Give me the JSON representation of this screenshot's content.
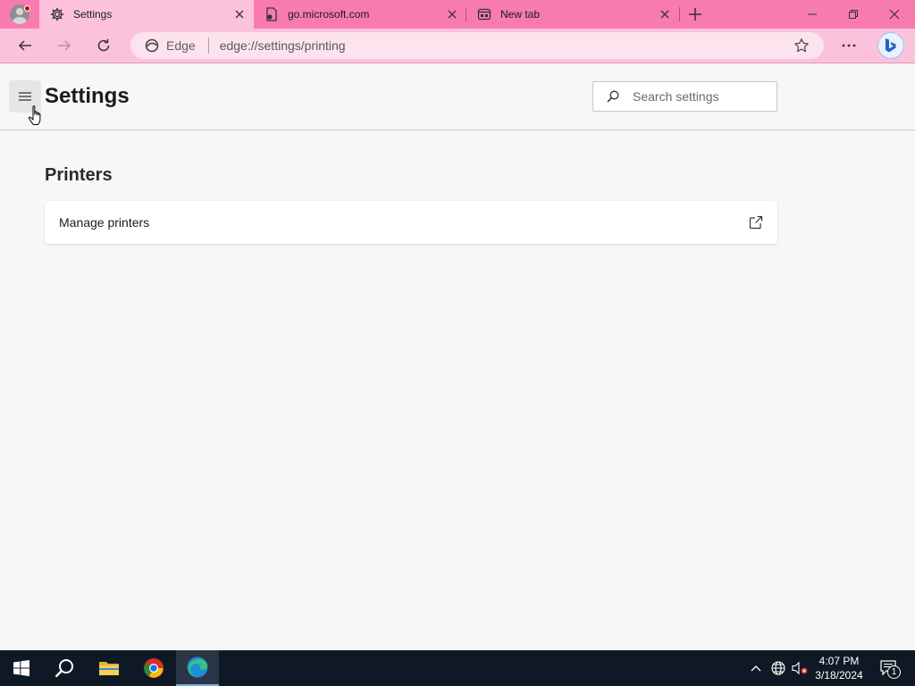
{
  "browser": {
    "tabs": [
      {
        "label": "Settings",
        "icon": "gear-icon",
        "active": true
      },
      {
        "label": "go.microsoft.com",
        "icon": "pdf-icon",
        "active": false
      },
      {
        "label": "New tab",
        "icon": "newtab-page-icon",
        "active": false
      }
    ],
    "omnibox": {
      "site_label": "Edge",
      "url": "edge://settings/printing"
    },
    "colors": {
      "tabstrip": "#f87bb0",
      "active_tab": "#fdc2db",
      "toolbar": "#fdc2db"
    }
  },
  "settings": {
    "title": "Settings",
    "search": {
      "placeholder": "Search settings"
    },
    "section_title": "Printers",
    "items": [
      {
        "label": "Manage printers",
        "icon": "external-link-icon"
      }
    ]
  },
  "taskbar": {
    "time": "4:07 PM",
    "date": "3/18/2024",
    "notification_count": "1",
    "apps": [
      "start-icon",
      "search-icon",
      "file-explorer-icon",
      "chrome-icon",
      "edge-icon"
    ]
  }
}
